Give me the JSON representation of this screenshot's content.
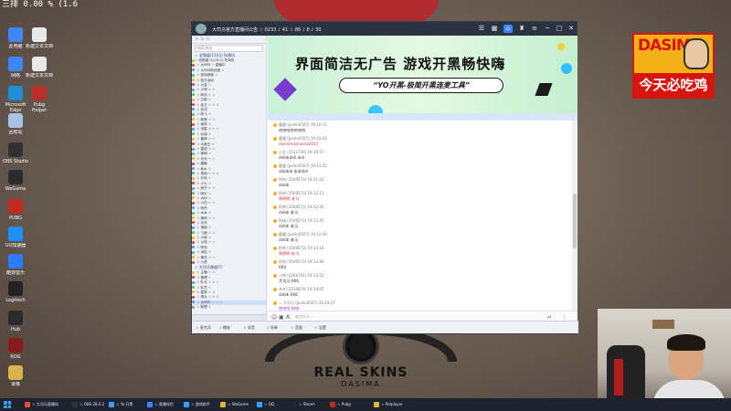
{
  "corner_text": "三排 0.00 % (1.6",
  "desktop_icons": [
    {
      "name": "computer-icon",
      "label": "此电脑",
      "color": "#3d86ff"
    },
    {
      "name": "file-icon",
      "label": "新建文本文档",
      "color": "#e9e9e9"
    },
    {
      "name": "settings-icon",
      "label": "网络",
      "color": "#3d86ff"
    },
    {
      "name": "file-icon-2",
      "label": "新建文本文档",
      "color": "#e9e9e9"
    },
    {
      "name": "edge-icon",
      "label": "Microsoft Edge",
      "color": "#1e8fd6"
    },
    {
      "name": "game-icon",
      "label": "Pubg Helper",
      "color": "#b83228"
    },
    {
      "name": "recycle-icon",
      "label": "回收站",
      "color": "#a9c4e3"
    },
    {
      "name": "obs-icon",
      "label": "OBS Studio",
      "color": "#303030"
    },
    {
      "name": "steam-icon",
      "label": "WeGame",
      "color": "#2b2b2b"
    },
    {
      "name": "app-red-icon",
      "label": "PUBG",
      "color": "#c22a1f"
    },
    {
      "name": "app-blue-icon",
      "label": "UU加速器",
      "color": "#1e90ff"
    },
    {
      "name": "k-icon",
      "label": "酷狗音乐",
      "color": "#2e7bff"
    },
    {
      "name": "app-dark-icon",
      "label": "Logitech",
      "color": "#222222"
    },
    {
      "name": "app-dark-icon-2",
      "label": "Hub",
      "color": "#2a2a2a"
    },
    {
      "name": "app-red-icon-2",
      "label": "ROG",
      "color": "#8a1b1b"
    },
    {
      "name": "folder-icon",
      "label": "录像",
      "color": "#d9b34b"
    }
  ],
  "badge": {
    "top": "DASIMA",
    "bottom": "今天必吃鸡"
  },
  "brand": {
    "title": "REAL SKINS",
    "subtitle": "DASIMA"
  },
  "window": {
    "title": "大司马官方直播间公告 ☆ 0233 ♪ 41 ☆ 86 ♪ 8 ♪ 30"
  },
  "left_panel": {
    "toolbar": "☆ ☆ ☆",
    "search_placeholder": "搜索频道",
    "channel_title": "☆ 全频道(11)(1) 仅通讯",
    "rows": [
      "─ 全频道 (1)(5)(1) 吃鸡仅",
      "  ☆ 大司马 ☆ 直播中",
      "  ☆ 大司马粉丝团 ☆",
      "  ☆ 游戏频道 ☆",
      "  ☆ 官方活动",
      "  ☆ 公会 ☆",
      "    ☆ 小明 ☆ ☆",
      "    ☆ 阿伟 ☆ ☆",
      "    ☆ 白菜 ☆",
      "    ☆ 老王 ☆ ☆ ☆",
      "    ☆ 花花",
      "    ☆ 阿飞 ☆",
      "    ☆ 辉哥 ☆ ☆",
      "    ☆ 南风 ☆",
      "    ☆ 流星 ☆ ☆ ☆",
      "    ☆ 北城 ☆",
      "    ☆ 雷神 ☆ ☆",
      "    ☆ 大魔王 ☆",
      "    ☆ 星辰 ☆ ☆",
      "    ☆ 琦琦 ☆",
      "    ☆ 月光 ☆ ☆",
      "    ☆ 晨曦",
      "    ☆ 秋水 ☆",
      "    ☆ 夜雨 ☆ ☆ ☆",
      "    ☆ 长风 ☆",
      "    ☆ 小七 ☆",
      "    ☆ 浪子 ☆ ☆",
      "    ☆ 阿乐 ☆",
      "    ☆ 大树 ☆",
      "    ☆ 小白 ☆ ☆",
      "    ☆ 阿杰",
      "    ☆ 木木 ☆",
      "    ☆ 清风 ☆ ☆",
      "    ☆ 天天",
      "    ☆ 海浪 ☆",
      "    ☆ 飞鱼 ☆ ☆",
      "    ☆ 小鱼 ☆",
      "    ☆ 火焰 ☆ ☆",
      "    ☆ 阿布",
      "    ☆ 米粒 ☆",
      "    ☆ 雪花 ☆ ☆",
      "    ☆ 小虎"
    ],
    "channel_title_2": "☆ 大司马频道(7)",
    "rows2": [
      "  ☆ 主播 ☆ ☆",
      "  ☆ 管理 ☆",
      "  ☆ 队长 ☆ ☆ ☆",
      "  ☆ 队员 ☆",
      "  ☆ 嘉宾 ☆ ☆",
      "  ☆ 观众 ☆ ☆ ☆",
      "  ☆ 大司马 ☆ ☆ ☆",
      "  ☆ 助理 ☆"
    ]
  },
  "banner": {
    "headline": "界面简洁无广告 游戏开黑畅快嗨",
    "pill": "“YO开黑-极简开黑连麦工具”"
  },
  "chat": {
    "messages": [
      {
        "meta": "鹿鹿 (Junlin0507) 19:10:11",
        "body": "哈哈哈哈哈哈哈",
        "color": "#333333"
      },
      {
        "meta": "鹿鹿 (Junlin0507) 19:10:43",
        "body": "dashimashasha2017",
        "color": "#d43c3c"
      },
      {
        "meta": "小丑 (3512736) 19:10:57",
        "body": "dididididi didi",
        "color": "#333333"
      },
      {
        "meta": "鹿鹿 (Junlin0507) 19:11:25",
        "body": "didididi didididi",
        "color": "#333333"
      },
      {
        "meta": "阿伟 (3509573) 19:11:41",
        "body": "dididi",
        "color": "#333333"
      },
      {
        "meta": "阿伟 (3509573) 19:12:11",
        "body": "啊啊啊 老马",
        "color": "#d43c3c"
      },
      {
        "meta": "阿伟 (3509573) 19:12:30",
        "body": "dididi 老马",
        "color": "#333333"
      },
      {
        "meta": "阿伟 (3509573) 19:12:45",
        "body": "dididi 老马",
        "color": "#333333"
      },
      {
        "meta": "鹿鹿 (Junlin0507) 19:12:59",
        "body": "dididi 老马",
        "color": "#333333"
      },
      {
        "meta": "阿伟 (3509573) 19:13:16",
        "body": "啊啊啊 老马",
        "color": "#d43c3c"
      },
      {
        "meta": "阿伟 (3509573) 19:13:40",
        "body": "666",
        "color": "#333333"
      },
      {
        "meta": "小明 (2266702) 19:13:52",
        "body": "大司马 666",
        "color": "#333333"
      },
      {
        "meta": "木木 (2316879) 19:14:05",
        "body": "dididi 666",
        "color": "#333333"
      },
      {
        "meta": "☆ 大司马 (Junlin0507) 19:14:27",
        "body": "哈哈哈 哈哈",
        "color": "#b02cc9"
      },
      {
        "meta": "鹿鹿 (Junlin0507) 19:14:58",
        "body": "哈哈哈",
        "color": "#d43c3c"
      }
    ],
    "input_placeholder": "说点什么..."
  },
  "statusbar": {
    "items": [
      "☆ 麦克风",
      "♪ 播放",
      "☆ 录音",
      "♪ 伴奏",
      "☆ 音量",
      "☆ 设置"
    ]
  },
  "taskbar": {
    "items": [
      {
        "label": "☆ 大司马直播间",
        "color": "#e74c3c"
      },
      {
        "label": "☆ OBS 28.0.2",
        "color": "#333333"
      },
      {
        "label": "☆ Yo 开黑",
        "color": "#3aa0ff"
      },
      {
        "label": "☆ 直播伴侣",
        "color": "#3d86ff"
      },
      {
        "label": "☆ 游戏助手",
        "color": "#3aa0ff"
      },
      {
        "label": "☆ WeGame",
        "color": "#e6b430"
      },
      {
        "label": "☆ QQ",
        "color": "#3aa0ff"
      },
      {
        "label": "☆ Steam",
        "color": "#1b2838"
      },
      {
        "label": "☆ Pubg",
        "color": "#c22a1f"
      },
      {
        "label": "☆ Potplayer",
        "color": "#e6b430"
      }
    ]
  }
}
